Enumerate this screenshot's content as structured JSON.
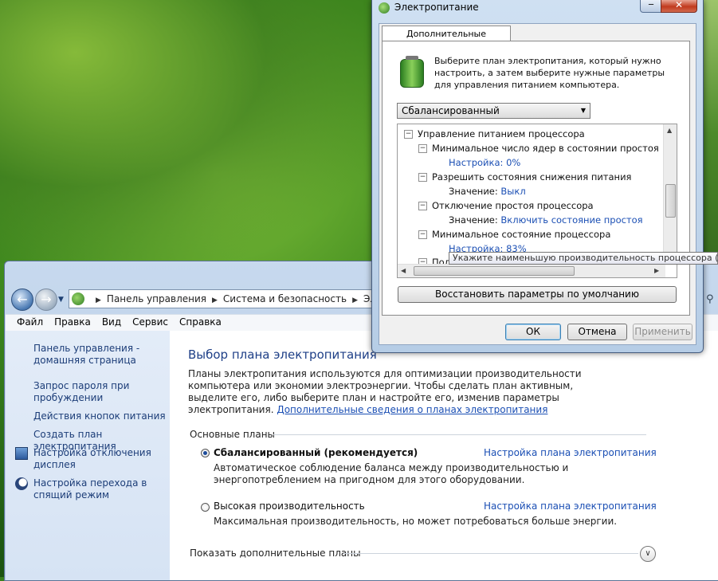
{
  "control_panel": {
    "address": {
      "crumbs": [
        "Панель управления",
        "Система и безопасность",
        "Электро"
      ]
    },
    "menu": [
      "Файл",
      "Правка",
      "Вид",
      "Сервис",
      "Справка"
    ],
    "left_links": {
      "home": "Панель управления - домашняя страница",
      "wake_password": "Запрос пароля при пробуждении",
      "power_buttons": "Действия кнопок питания",
      "create_plan": "Создать план электропитания",
      "display_off": "Настройка отключения дисплея",
      "sleep": "Настройка перехода в спящий режим"
    },
    "main": {
      "title": "Выбор плана электропитания",
      "description": "Планы электропитания используются для оптимизации производительности компьютера или экономии электроэнергии. Чтобы сделать план активным, выделите его, либо выберите план и настройте его, изменив параметры электропитания. ",
      "description_link": "Дополнительные сведения о планах электропитания",
      "section": "Основные планы",
      "plans": [
        {
          "name": "Сбалансированный (рекомендуется)",
          "link": "Настройка плана электропитания",
          "desc": "Автоматическое соблюдение баланса между производительностью и энергопотреблением на пригодном для этого оборудовании.",
          "selected": true
        },
        {
          "name": "Высокая производительность",
          "link": "Настройка плана электропитания",
          "desc": "Максимальная производительность, но может потребоваться больше энергии.",
          "selected": false
        }
      ],
      "more_plans": "Показать дополнительные планы"
    }
  },
  "dialog": {
    "title": "Электропитание",
    "tab": "Дополнительные параметры",
    "intro": "Выберите план электропитания, который нужно настроить, а затем выберите нужные параметры для управления питанием компьютера.",
    "plan_select": "Сбалансированный",
    "tree": {
      "group": "Управление питанием процессора",
      "min_cores": "Минимальное число ядер в состоянии простоя",
      "min_cores_label": "Настройка:",
      "min_cores_value": "0%",
      "allow_throttle": "Разрешить состояния снижения питания",
      "allow_throttle_label": "Значение:",
      "allow_throttle_value": "Выкл",
      "idle_disable": "Отключение простоя процессора",
      "idle_disable_label": "Значение:",
      "idle_disable_value": "Включить состояние простоя",
      "min_state": "Минимальное состояние процессора",
      "min_state_label": "Настройка:",
      "min_state_value": "83%",
      "next_partial": "Под"
    },
    "tooltip": "Укажите наименьшую производительность процессора (в п",
    "restore_button": "Восстановить параметры по умолчанию",
    "ok": "ОК",
    "cancel": "Отмена",
    "apply": "Применить"
  }
}
